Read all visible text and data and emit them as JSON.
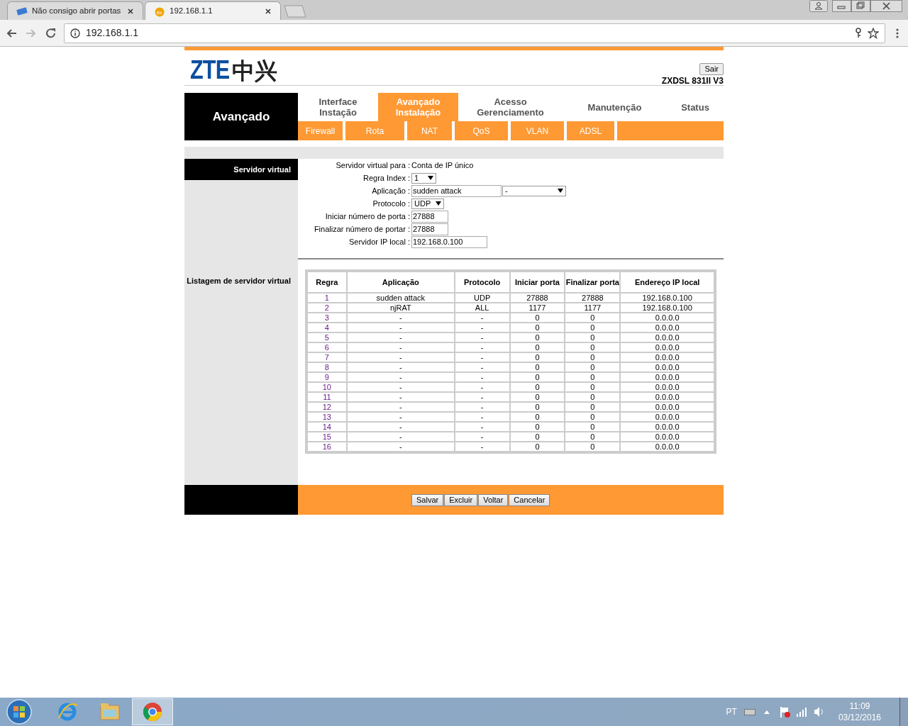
{
  "browser": {
    "tabs": [
      {
        "title": "Não consigo abrir portas",
        "selected": false
      },
      {
        "title": "192.168.1.1",
        "selected": true
      }
    ],
    "forward_disabled": true,
    "address": "192.168.1.1"
  },
  "header": {
    "logo_latin": "ZTE",
    "logo_chinese": "中兴",
    "logout": "Sair",
    "model": "ZXDSL 831II V3"
  },
  "section_title": "Avançado",
  "main_tabs": [
    {
      "label": "Interface Instação",
      "selected": false
    },
    {
      "label": "Avançado Instalação",
      "selected": true
    },
    {
      "label": "Acesso Gerenciamento",
      "selected": false
    },
    {
      "label": "Manutenção",
      "selected": false
    },
    {
      "label": "Status",
      "selected": false
    }
  ],
  "sub_tabs": [
    "Firewall",
    "Rota",
    "NAT",
    "QoS",
    "VLAN",
    "ADSL"
  ],
  "sidebar": {
    "heading": "Servidor virtual",
    "list_label": "Listagem de servidor virtual"
  },
  "form": [
    {
      "kind": "text",
      "label": "Servidor virtual para :",
      "value": "Conta de IP único"
    },
    {
      "kind": "select",
      "label": "Regra Index :",
      "value": "1"
    },
    {
      "kind": "input_select",
      "label": "Aplicação :",
      "value": "sudden attack",
      "select": "-"
    },
    {
      "kind": "select",
      "label": "Protocolo :",
      "value": "UDP"
    },
    {
      "kind": "input",
      "label": "Iniciar número de porta :",
      "value": "27888"
    },
    {
      "kind": "input",
      "label": "Finalizar número de portar :",
      "value": "27888"
    },
    {
      "kind": "input",
      "label": "Servidor IP local :",
      "value": "192.168.0.100",
      "wide": true
    }
  ],
  "table": {
    "columns": [
      "Regra",
      "Aplicação",
      "Protocolo",
      "Iniciar porta",
      "Finalizar porta",
      "Endereço IP local"
    ],
    "rows": [
      [
        "1",
        "sudden attack",
        "UDP",
        "27888",
        "27888",
        "192.168.0.100"
      ],
      [
        "2",
        "njRAT",
        "ALL",
        "1177",
        "1177",
        "192.168.0.100"
      ],
      [
        "3",
        "-",
        "-",
        "0",
        "0",
        "0.0.0.0"
      ],
      [
        "4",
        "-",
        "-",
        "0",
        "0",
        "0.0.0.0"
      ],
      [
        "5",
        "-",
        "-",
        "0",
        "0",
        "0.0.0.0"
      ],
      [
        "6",
        "-",
        "-",
        "0",
        "0",
        "0.0.0.0"
      ],
      [
        "7",
        "-",
        "-",
        "0",
        "0",
        "0.0.0.0"
      ],
      [
        "8",
        "-",
        "-",
        "0",
        "0",
        "0.0.0.0"
      ],
      [
        "9",
        "-",
        "-",
        "0",
        "0",
        "0.0.0.0"
      ],
      [
        "10",
        "-",
        "-",
        "0",
        "0",
        "0.0.0.0"
      ],
      [
        "11",
        "-",
        "-",
        "0",
        "0",
        "0.0.0.0"
      ],
      [
        "12",
        "-",
        "-",
        "0",
        "0",
        "0.0.0.0"
      ],
      [
        "13",
        "-",
        "-",
        "0",
        "0",
        "0.0.0.0"
      ],
      [
        "14",
        "-",
        "-",
        "0",
        "0",
        "0.0.0.0"
      ],
      [
        "15",
        "-",
        "-",
        "0",
        "0",
        "0.0.0.0"
      ],
      [
        "16",
        "-",
        "-",
        "0",
        "0",
        "0.0.0.0"
      ]
    ]
  },
  "buttons": [
    "Salvar",
    "Excluir",
    "Voltar",
    "Cancelar"
  ],
  "taskbar": {
    "apps": [
      {
        "kind": "ie",
        "active": false
      },
      {
        "kind": "folder",
        "active": false
      },
      {
        "kind": "chrome",
        "active": true
      }
    ],
    "language": "PT",
    "time": "11:09",
    "date": "03/12/2016"
  }
}
